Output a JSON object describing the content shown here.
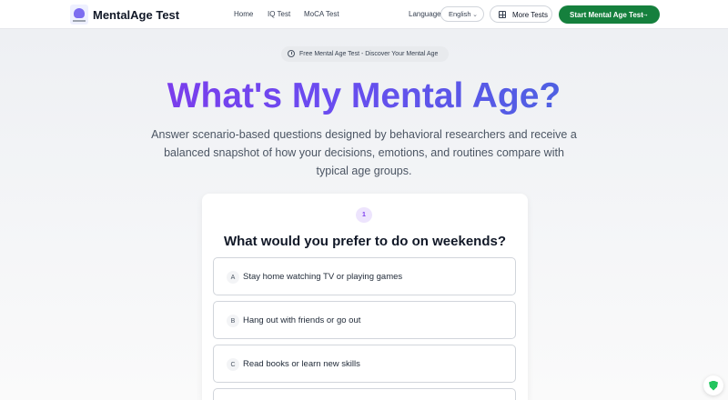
{
  "header": {
    "brand": "MentalAge Test",
    "nav": [
      "Home",
      "IQ Test",
      "MoCA Test"
    ],
    "language_label": "Language",
    "language_value": "English",
    "more_tests": "More Tests",
    "start_button": "Start Mental Age Test"
  },
  "hero": {
    "badge": "Free Mental Age Test - Discover Your Mental Age",
    "title": "What's My Mental Age?",
    "subtitle": "Answer scenario-based questions designed by behavioral researchers and receive a balanced snapshot of how your decisions, emotions, and routines compare with typical age groups."
  },
  "quiz": {
    "question_number": "1",
    "question": "What would you prefer to do on weekends?",
    "options": [
      {
        "letter": "A",
        "text": "Stay home watching TV or playing games"
      },
      {
        "letter": "B",
        "text": "Hang out with friends or go out"
      },
      {
        "letter": "C",
        "text": "Read books or learn new skills"
      }
    ]
  },
  "colors": {
    "accent_green": "#15803d",
    "title_gradient_start": "#8b2fe8",
    "title_gradient_end": "#3b6fd8"
  },
  "icons": [
    "clock-icon",
    "grid-icon",
    "arrow-right-icon",
    "chevron-down-icon",
    "shield-icon"
  ]
}
